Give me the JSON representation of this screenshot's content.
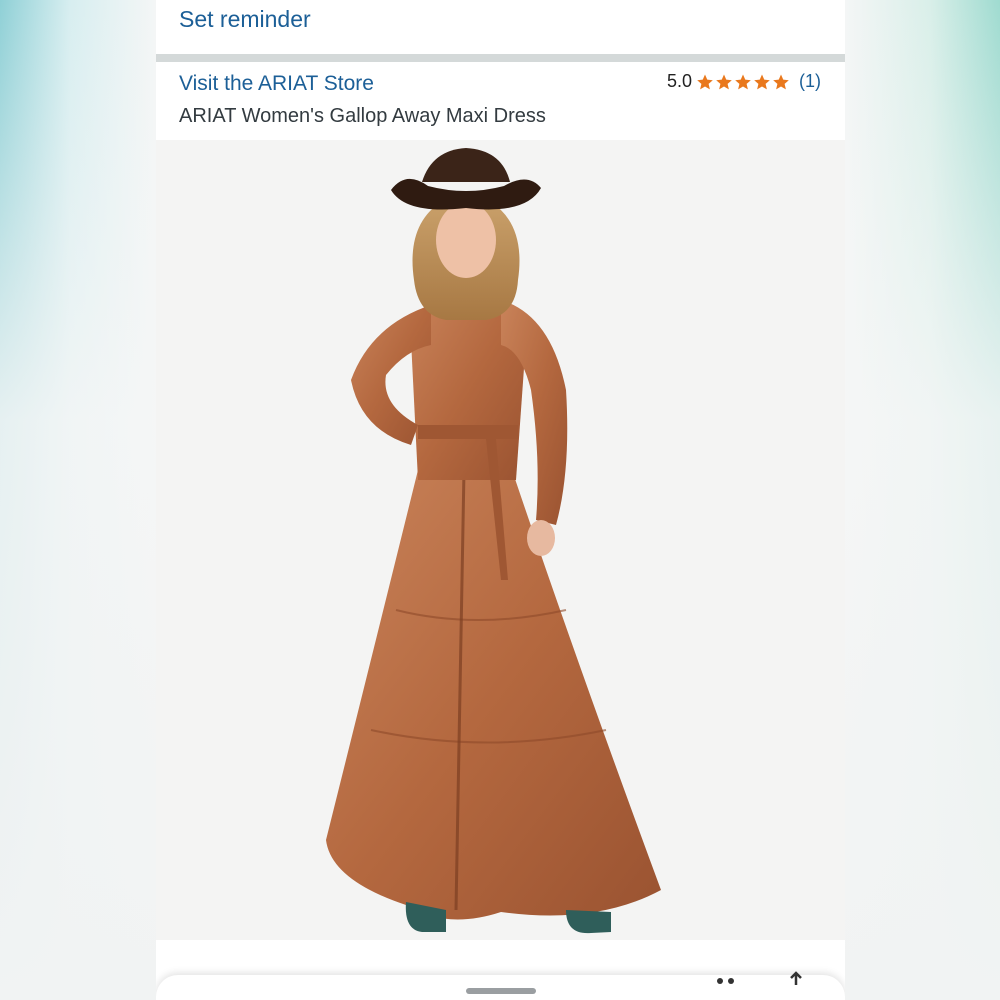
{
  "reminder": {
    "label": "Set reminder"
  },
  "product": {
    "store_link": "Visit the ARIAT Store",
    "title": "ARIAT Women's Gallop Away Maxi Dress",
    "rating": {
      "value": "5.0",
      "stars": 5,
      "count_label": "(1)"
    },
    "image": {
      "alt": "Model wearing rust horse-print tiered maxi shirt dress with brown cowboy hat and teal boots"
    }
  },
  "icons": {
    "star": "star-icon",
    "more": "more-options-icon",
    "share": "share-icon"
  },
  "colors": {
    "link": "#1c5f97",
    "star": "#e9781d",
    "text": "#333b40",
    "separator": "#d4d9d9"
  }
}
